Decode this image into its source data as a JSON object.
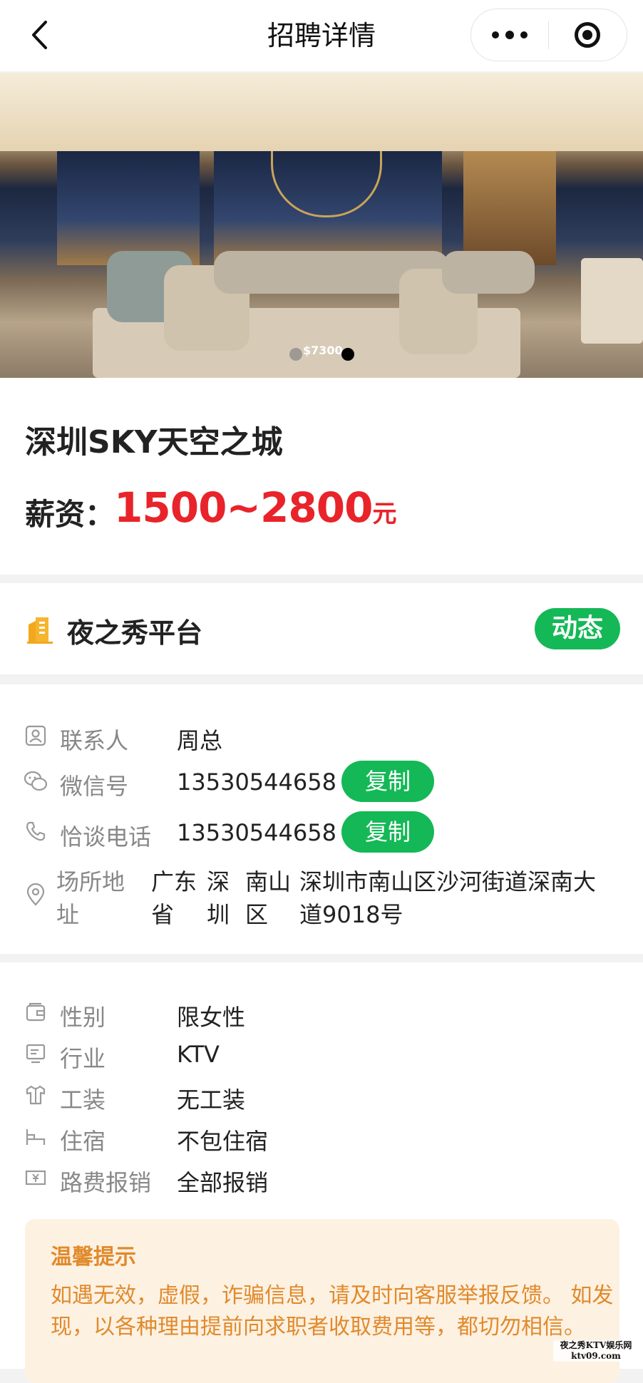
{
  "nav": {
    "title": "招聘详情",
    "back_icon": "chevron-left-icon",
    "more_icon": "more-dots-icon",
    "close_icon": "target-circle-icon"
  },
  "banner": {
    "watermark": "$7300",
    "carousel_count": 2,
    "carousel_active_index": 1
  },
  "job": {
    "title": "深圳SKY天空之城",
    "salary_label": "薪资：",
    "salary_value": "1500~2800",
    "salary_unit": "元"
  },
  "platform": {
    "name": "夜之秀平台",
    "icon": "building-icon",
    "dynamic_button": "动态"
  },
  "contact": {
    "contact_person": {
      "label": "联系人",
      "value": "周总",
      "icon": "contact-card-icon"
    },
    "wechat": {
      "label": "微信号",
      "value": "13530544658",
      "copy": "复制",
      "icon": "wechat-icon"
    },
    "phone": {
      "label": "恰谈电话",
      "value": "13530544658",
      "copy": "复制",
      "icon": "phone-icon"
    },
    "location": {
      "label_line1": "场所地",
      "label_line2": "址",
      "province_1": "广东",
      "province_2": "省",
      "city_1": "深",
      "city_2": "圳",
      "district_1": "南山",
      "district_2": "区",
      "address_1": "深圳市南山区沙河街道深南大",
      "address_2": "道9018号",
      "icon": "location-pin-icon"
    }
  },
  "details": [
    {
      "label": "性别",
      "value": "限女性",
      "icon": "wallet-icon"
    },
    {
      "label": "行业",
      "value": "KTV",
      "icon": "monitor-icon"
    },
    {
      "label": "工装",
      "value": "无工装",
      "icon": "shirt-icon"
    },
    {
      "label": "住宿",
      "value": "不包住宿",
      "icon": "bed-icon"
    },
    {
      "label": "路费报销",
      "value": "全部报销",
      "icon": "money-icon"
    }
  ],
  "tips": {
    "title": "温馨提示",
    "text": "如遇无效，虚假，诈骗信息，请及时向客服举报反馈。 如发现，以各种理由提前向求职者收取费用等，都切勿相信。"
  },
  "site_watermark": {
    "line1": "夜之秀KTV娱乐网",
    "line2": "ktv09.com"
  },
  "colors": {
    "accent_green": "#14b856",
    "salary_red": "#e8242a",
    "tips_orange": "#e08a2c",
    "tips_bg": "#fdf1e2"
  }
}
